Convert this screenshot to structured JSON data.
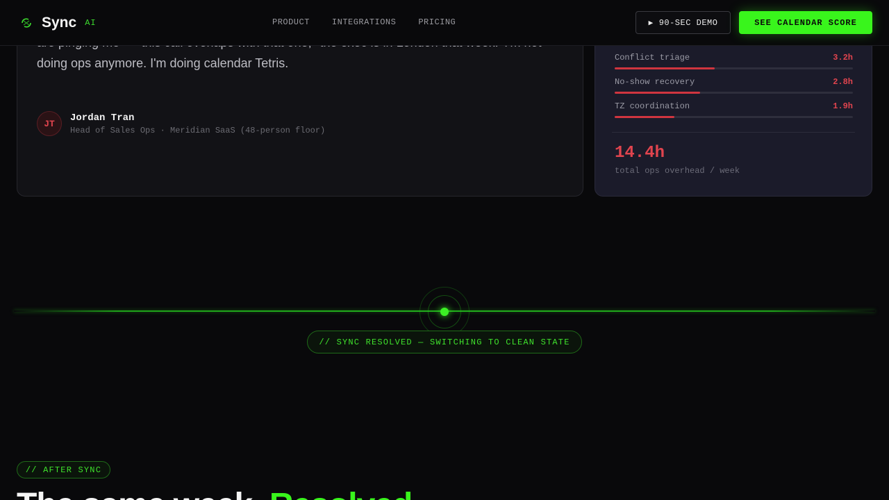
{
  "header": {
    "logo_text": "Sync",
    "logo_badge": "AI",
    "nav": [
      "PRODUCT",
      "INTEGRATIONS",
      "PRICING"
    ],
    "demo_button": "90-SEC DEMO",
    "cta_button": "SEE CALENDAR SCORE",
    "colors": {
      "accent": "#39f51c",
      "background": "#09090b"
    }
  },
  "testimonial": {
    "quote": "are pinging me — 'this call overlaps with that one,' 'the exec is in London that week.' I'm not doing ops anymore. I'm doing calendar Tetris.",
    "author_initials": "JT",
    "author_name": "Jordan Tran",
    "author_role": "Head of Sales Ops · Meridian SaaS (48-person floor)"
  },
  "overhead": {
    "rows": [
      {
        "label": "Conflict triage",
        "value": "3.2h",
        "fill_percent": 42
      },
      {
        "label": "No-show recovery",
        "value": "2.8h",
        "fill_percent": 36
      },
      {
        "label": "TZ coordination",
        "value": "1.9h",
        "fill_percent": 25
      }
    ],
    "total": "14.4h",
    "total_caption": "total ops overhead / week",
    "bar_color": "#d0353f"
  },
  "divider": {
    "label": "// SYNC RESOLVED — SWITCHING TO CLEAN STATE"
  },
  "after": {
    "tag": "// AFTER SYNC",
    "heading_plain": "The same week.",
    "heading_accent": "Resolved."
  }
}
